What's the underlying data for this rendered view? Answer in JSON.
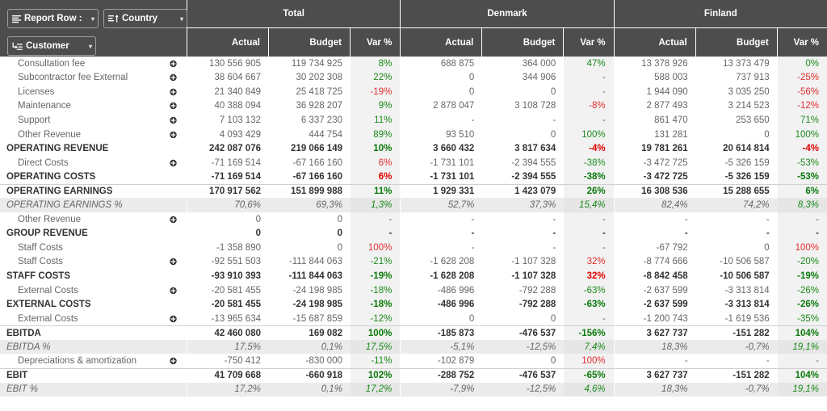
{
  "header": {
    "dimension_buttons": [
      {
        "id": "report-row",
        "label": "Report Row :",
        "icon": "list-icon"
      },
      {
        "id": "country",
        "label": "Country",
        "icon": "list-sort-asc-icon"
      },
      {
        "id": "customer",
        "label": "Customer",
        "icon": "drill-down-icon"
      }
    ],
    "caret": "▾",
    "groups": [
      {
        "id": "total",
        "title": "Total"
      },
      {
        "id": "denmark",
        "title": "Denmark"
      },
      {
        "id": "finland",
        "title": "Finland"
      }
    ],
    "measures": [
      "Actual",
      "Budget",
      "Var %"
    ]
  },
  "chart_data": {
    "type": "table",
    "title": "Total / Denmark / Finland P&L comparison",
    "column_groups": [
      "Total",
      "Denmark",
      "Finland"
    ],
    "measures": [
      "Actual",
      "Budget",
      "Var %"
    ],
    "rows": [
      {
        "label": "Consultation fee",
        "kind": "item",
        "expandable": true,
        "total": {
          "actual": "130 556 905",
          "budget": "119 734 925",
          "var": "8%",
          "var_sign": "pos"
        },
        "denmark": {
          "actual": "688 875",
          "budget": "364 000",
          "var": "47%",
          "var_sign": "pos"
        },
        "finland": {
          "actual": "13 378 926",
          "budget": "13 373 479",
          "var": "0%",
          "var_sign": "pos"
        }
      },
      {
        "label": "Subcontractor fee External",
        "kind": "item",
        "expandable": true,
        "total": {
          "actual": "38 604 667",
          "budget": "30 202 308",
          "var": "22%",
          "var_sign": "pos"
        },
        "denmark": {
          "actual": "0",
          "budget": "344 906",
          "var": "-",
          "var_sign": "none"
        },
        "finland": {
          "actual": "588 003",
          "budget": "737 913",
          "var": "-25%",
          "var_sign": "neg"
        }
      },
      {
        "label": "Licenses",
        "kind": "item",
        "expandable": true,
        "total": {
          "actual": "21 340 849",
          "budget": "25 418 725",
          "var": "-19%",
          "var_sign": "neg"
        },
        "denmark": {
          "actual": "0",
          "budget": "0",
          "var": "-",
          "var_sign": "none"
        },
        "finland": {
          "actual": "1 944 090",
          "budget": "3 035 250",
          "var": "-56%",
          "var_sign": "neg"
        }
      },
      {
        "label": "Maintenance",
        "kind": "item",
        "expandable": true,
        "total": {
          "actual": "40 388 094",
          "budget": "36 928 207",
          "var": "9%",
          "var_sign": "pos"
        },
        "denmark": {
          "actual": "2 878 047",
          "budget": "3 108 728",
          "var": "-8%",
          "var_sign": "neg"
        },
        "finland": {
          "actual": "2 877 493",
          "budget": "3 214 523",
          "var": "-12%",
          "var_sign": "neg"
        }
      },
      {
        "label": "Support",
        "kind": "item",
        "expandable": true,
        "total": {
          "actual": "7 103 132",
          "budget": "6 337 230",
          "var": "11%",
          "var_sign": "pos"
        },
        "denmark": {
          "actual": "-",
          "budget": "-",
          "var": "-",
          "var_sign": "none"
        },
        "finland": {
          "actual": "861 470",
          "budget": "253 650",
          "var": "71%",
          "var_sign": "pos"
        }
      },
      {
        "label": "Other Revenue",
        "kind": "item",
        "expandable": true,
        "total": {
          "actual": "4 093 429",
          "budget": "444 754",
          "var": "89%",
          "var_sign": "pos"
        },
        "denmark": {
          "actual": "93 510",
          "budget": "0",
          "var": "100%",
          "var_sign": "pos"
        },
        "finland": {
          "actual": "131 281",
          "budget": "0",
          "var": "100%",
          "var_sign": "pos"
        }
      },
      {
        "label": "OPERATING REVENUE",
        "kind": "total",
        "expandable": false,
        "total": {
          "actual": "242 087 076",
          "budget": "219 066 149",
          "var": "10%",
          "var_sign": "pos"
        },
        "denmark": {
          "actual": "3 660 432",
          "budget": "3 817 634",
          "var": "-4%",
          "var_sign": "neg"
        },
        "finland": {
          "actual": "19 781 261",
          "budget": "20 614 814",
          "var": "-4%",
          "var_sign": "neg"
        }
      },
      {
        "label": "Direct Costs",
        "kind": "item",
        "expandable": true,
        "total": {
          "actual": "-71 169 514",
          "budget": "-67 166 160",
          "var": "6%",
          "var_sign": "neg"
        },
        "denmark": {
          "actual": "-1 731 101",
          "budget": "-2 394 555",
          "var": "-38%",
          "var_sign": "pos"
        },
        "finland": {
          "actual": "-3 472 725",
          "budget": "-5 326 159",
          "var": "-53%",
          "var_sign": "pos"
        }
      },
      {
        "label": "OPERATING COSTS",
        "kind": "total",
        "expandable": false,
        "total": {
          "actual": "-71 169 514",
          "budget": "-67 166 160",
          "var": "6%",
          "var_sign": "neg"
        },
        "denmark": {
          "actual": "-1 731 101",
          "budget": "-2 394 555",
          "var": "-38%",
          "var_sign": "pos"
        },
        "finland": {
          "actual": "-3 472 725",
          "budget": "-5 326 159",
          "var": "-53%",
          "var_sign": "pos"
        }
      },
      {
        "label": "OPERATING EARNINGS",
        "kind": "total",
        "expandable": false,
        "separator": true,
        "total": {
          "actual": "170 917 562",
          "budget": "151 899 988",
          "var": "11%",
          "var_sign": "pos"
        },
        "denmark": {
          "actual": "1 929 331",
          "budget": "1 423 079",
          "var": "26%",
          "var_sign": "pos"
        },
        "finland": {
          "actual": "16 308 536",
          "budget": "15 288 655",
          "var": "6%",
          "var_sign": "pos"
        }
      },
      {
        "label": "OPERATING EARNINGS %",
        "kind": "pct",
        "expandable": false,
        "shaded": true,
        "total": {
          "actual": "70,6%",
          "budget": "69,3%",
          "var": "1,3%",
          "var_sign": "pos"
        },
        "denmark": {
          "actual": "52,7%",
          "budget": "37,3%",
          "var": "15,4%",
          "var_sign": "pos"
        },
        "finland": {
          "actual": "82,4%",
          "budget": "74,2%",
          "var": "8,3%",
          "var_sign": "pos"
        }
      },
      {
        "label": "Other Revenue",
        "kind": "item",
        "expandable": true,
        "total": {
          "actual": "0",
          "budget": "0",
          "var": "-",
          "var_sign": "none"
        },
        "denmark": {
          "actual": "-",
          "budget": "-",
          "var": "-",
          "var_sign": "none"
        },
        "finland": {
          "actual": "-",
          "budget": "-",
          "var": "-",
          "var_sign": "none"
        }
      },
      {
        "label": "GROUP REVENUE",
        "kind": "total",
        "expandable": false,
        "total": {
          "actual": "0",
          "budget": "0",
          "var": "-",
          "var_sign": "none"
        },
        "denmark": {
          "actual": "-",
          "budget": "-",
          "var": "-",
          "var_sign": "none"
        },
        "finland": {
          "actual": "-",
          "budget": "-",
          "var": "-",
          "var_sign": "none"
        }
      },
      {
        "label": "Staff Costs",
        "kind": "item",
        "expandable": false,
        "total": {
          "actual": "-1 358 890",
          "budget": "0",
          "var": "100%",
          "var_sign": "neg"
        },
        "denmark": {
          "actual": "-",
          "budget": "-",
          "var": "-",
          "var_sign": "none"
        },
        "finland": {
          "actual": "-67 792",
          "budget": "0",
          "var": "100%",
          "var_sign": "neg"
        }
      },
      {
        "label": "Staff Costs",
        "kind": "item",
        "expandable": true,
        "total": {
          "actual": "-92 551 503",
          "budget": "-111 844 063",
          "var": "-21%",
          "var_sign": "pos"
        },
        "denmark": {
          "actual": "-1 628 208",
          "budget": "-1 107 328",
          "var": "32%",
          "var_sign": "neg"
        },
        "finland": {
          "actual": "-8 774 666",
          "budget": "-10 506 587",
          "var": "-20%",
          "var_sign": "pos"
        }
      },
      {
        "label": "STAFF COSTS",
        "kind": "total",
        "expandable": false,
        "total": {
          "actual": "-93 910 393",
          "budget": "-111 844 063",
          "var": "-19%",
          "var_sign": "pos"
        },
        "denmark": {
          "actual": "-1 628 208",
          "budget": "-1 107 328",
          "var": "32%",
          "var_sign": "neg"
        },
        "finland": {
          "actual": "-8 842 458",
          "budget": "-10 506 587",
          "var": "-19%",
          "var_sign": "pos"
        }
      },
      {
        "label": "External Costs",
        "kind": "item",
        "expandable": true,
        "total": {
          "actual": "-20 581 455",
          "budget": "-24 198 985",
          "var": "-18%",
          "var_sign": "pos"
        },
        "denmark": {
          "actual": "-486 996",
          "budget": "-792 288",
          "var": "-63%",
          "var_sign": "pos"
        },
        "finland": {
          "actual": "-2 637 599",
          "budget": "-3 313 814",
          "var": "-26%",
          "var_sign": "pos"
        }
      },
      {
        "label": "EXTERNAL COSTS",
        "kind": "total",
        "expandable": false,
        "total": {
          "actual": "-20 581 455",
          "budget": "-24 198 985",
          "var": "-18%",
          "var_sign": "pos"
        },
        "denmark": {
          "actual": "-486 996",
          "budget": "-792 288",
          "var": "-63%",
          "var_sign": "pos"
        },
        "finland": {
          "actual": "-2 637 599",
          "budget": "-3 313 814",
          "var": "-26%",
          "var_sign": "pos"
        }
      },
      {
        "label": "External Costs",
        "kind": "item",
        "expandable": true,
        "total": {
          "actual": "-13 965 634",
          "budget": "-15 687 859",
          "var": "-12%",
          "var_sign": "pos"
        },
        "denmark": {
          "actual": "0",
          "budget": "0",
          "var": "-",
          "var_sign": "none"
        },
        "finland": {
          "actual": "-1 200 743",
          "budget": "-1 619 536",
          "var": "-35%",
          "var_sign": "pos"
        }
      },
      {
        "label": "EBITDA",
        "kind": "total",
        "expandable": false,
        "separator": true,
        "total": {
          "actual": "42 460 080",
          "budget": "169 082",
          "var": "100%",
          "var_sign": "pos"
        },
        "denmark": {
          "actual": "-185 873",
          "budget": "-476 537",
          "var": "-156%",
          "var_sign": "pos"
        },
        "finland": {
          "actual": "3 627 737",
          "budget": "-151 282",
          "var": "104%",
          "var_sign": "pos"
        }
      },
      {
        "label": "EBITDA %",
        "kind": "pct",
        "expandable": false,
        "shaded": true,
        "total": {
          "actual": "17,5%",
          "budget": "0,1%",
          "var": "17,5%",
          "var_sign": "pos"
        },
        "denmark": {
          "actual": "-5,1%",
          "budget": "-12,5%",
          "var": "7,4%",
          "var_sign": "pos"
        },
        "finland": {
          "actual": "18,3%",
          "budget": "-0,7%",
          "var": "19,1%",
          "var_sign": "pos"
        }
      },
      {
        "label": "Depreciations & amortization",
        "kind": "item",
        "expandable": true,
        "total": {
          "actual": "-750 412",
          "budget": "-830 000",
          "var": "-11%",
          "var_sign": "pos"
        },
        "denmark": {
          "actual": "-102 879",
          "budget": "0",
          "var": "100%",
          "var_sign": "neg"
        },
        "finland": {
          "actual": "-",
          "budget": "-",
          "var": "-",
          "var_sign": "none"
        }
      },
      {
        "label": "EBIT",
        "kind": "total",
        "expandable": false,
        "separator": true,
        "total": {
          "actual": "41 709 668",
          "budget": "-660 918",
          "var": "102%",
          "var_sign": "pos"
        },
        "denmark": {
          "actual": "-288 752",
          "budget": "-476 537",
          "var": "-65%",
          "var_sign": "pos"
        },
        "finland": {
          "actual": "3 627 737",
          "budget": "-151 282",
          "var": "104%",
          "var_sign": "pos"
        }
      },
      {
        "label": "EBIT %",
        "kind": "pct",
        "expandable": false,
        "shaded": true,
        "total": {
          "actual": "17,2%",
          "budget": "0,1%",
          "var": "17,2%",
          "var_sign": "pos"
        },
        "denmark": {
          "actual": "-7,9%",
          "budget": "-12,5%",
          "var": "4,6%",
          "var_sign": "pos"
        },
        "finland": {
          "actual": "18,3%",
          "budget": "-0,7%",
          "var": "19,1%",
          "var_sign": "pos"
        }
      }
    ]
  },
  "colors": {
    "header_bg": "#4d4d4d",
    "positive": "#1a8a1a",
    "negative": "#e32d2d",
    "var_column_bg": "#f2f2f2",
    "shaded_row_bg": "#ebebeb"
  }
}
